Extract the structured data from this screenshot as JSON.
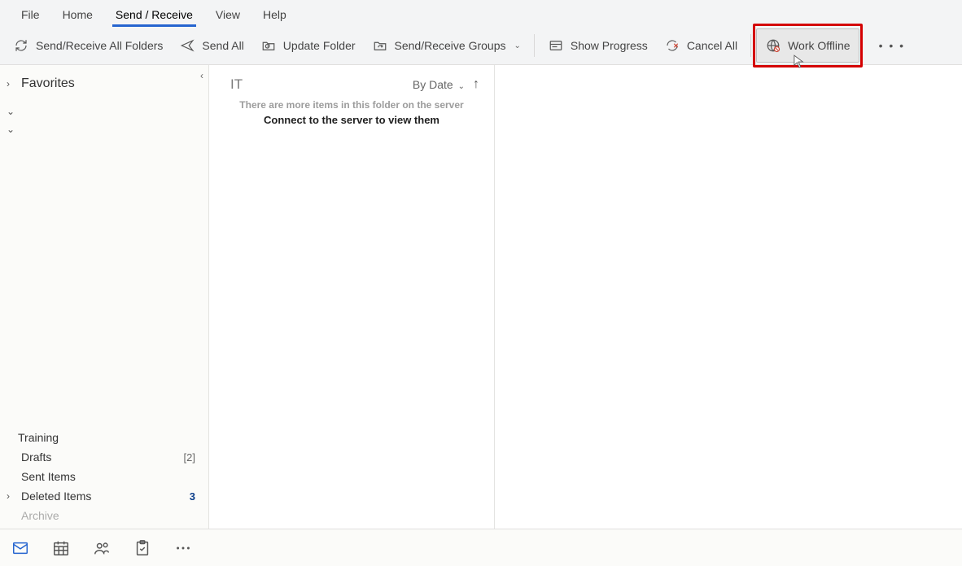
{
  "tabs": {
    "items": [
      "File",
      "Home",
      "Send / Receive",
      "View",
      "Help"
    ],
    "activeIndex": 2
  },
  "ribbon": {
    "sendReceiveAll": "Send/Receive All Folders",
    "sendAll": "Send All",
    "updateFolder": "Update Folder",
    "srGroups": "Send/Receive Groups",
    "showProgress": "Show Progress",
    "cancelAll": "Cancel All",
    "workOffline": "Work Offline",
    "moreLabel": "• • •"
  },
  "leftPane": {
    "favoritesHeader": "Favorites",
    "group1": "",
    "group2": "",
    "bottomFolders": [
      {
        "name": "Training",
        "count": "",
        "bold": false,
        "hasCaret": false
      },
      {
        "name": "Drafts",
        "count": "[2]",
        "bold": false,
        "hasCaret": false
      },
      {
        "name": "Sent Items",
        "count": "",
        "bold": false,
        "hasCaret": false
      },
      {
        "name": "Deleted Items",
        "count": "3",
        "bold": true,
        "hasCaret": true
      },
      {
        "name": "Archive",
        "count": "",
        "bold": false,
        "hasCaret": false
      }
    ]
  },
  "listPane": {
    "folderName": "IT",
    "sortLabel": "By Date",
    "line1": "There are more items in this folder on the server",
    "line2": "Connect to the server to view them"
  }
}
